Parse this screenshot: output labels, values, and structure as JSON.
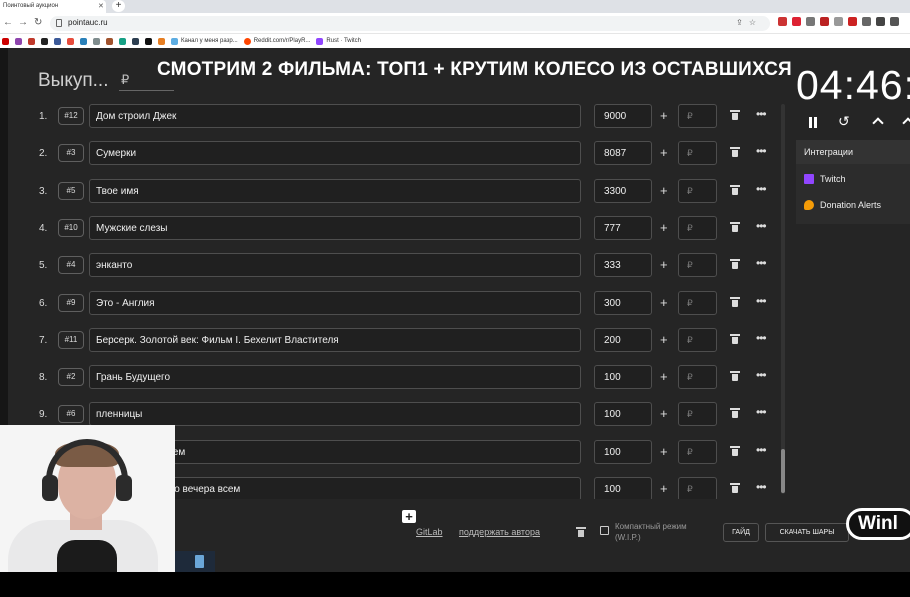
{
  "browser": {
    "tab_title": "Поинтовый аукцион",
    "url": "pointauc.ru",
    "bookmarks": [
      "Канал у меня разр...",
      "Reddit.com/r/PlayR...",
      "Rust · Twitch"
    ]
  },
  "header": {
    "title": "Выкуп...",
    "currency": "₽",
    "banner": "СМОТРИМ 2 ФИЛЬМА: ТОП1 + КРУТИМ КОЛЕСО ИЗ ОСТАВШИХСЯ",
    "timer": "04:46:"
  },
  "lot_input_placeholder": "₽",
  "lots": [
    {
      "rank": "1.",
      "id": "#12",
      "name": "Дом строил Джек",
      "amount": "9000"
    },
    {
      "rank": "2.",
      "id": "#3",
      "name": "Сумерки",
      "amount": "8087"
    },
    {
      "rank": "3.",
      "id": "#5",
      "name": "Твое имя",
      "amount": "3300"
    },
    {
      "rank": "4.",
      "id": "#10",
      "name": "Мужские слезы",
      "amount": "777"
    },
    {
      "rank": "5.",
      "id": "#4",
      "name": "энканто",
      "amount": "333"
    },
    {
      "rank": "6.",
      "id": "#9",
      "name": "Это - Англия",
      "amount": "300"
    },
    {
      "rank": "7.",
      "id": "#11",
      "name": "Берсерк. Золотой век: Фильм I. Бехелит Властителя",
      "amount": "200"
    },
    {
      "rank": "8.",
      "id": "#2",
      "name": "Грань Будущего",
      "amount": "100"
    },
    {
      "rank": "9.",
      "id": "#6",
      "name": "пленницы",
      "amount": "100"
    },
    {
      "rank": "10.",
      "id": "",
      "name": "коном Малковичем",
      "amount": "100"
    },
    {
      "rank": "11.",
      "id": "",
      "name": "я и Ирэн. Доброго вечера всем",
      "amount": "100"
    }
  ],
  "integrations": {
    "header": "Интеграции",
    "items": [
      "Twitch",
      "Donation Alerts"
    ]
  },
  "footer": {
    "gitlab": "GitLab",
    "support": "поддержать автора",
    "compact_mode": "Компактный режим (W.I.P.)",
    "guide_button": "ГАЙД",
    "download_button": "СКАЧАТЬ ШАРЫ",
    "winline": "Winl"
  },
  "colors": {
    "background": "#252525",
    "twitch": "#9146ff",
    "donation_alerts": "#f59c07"
  }
}
